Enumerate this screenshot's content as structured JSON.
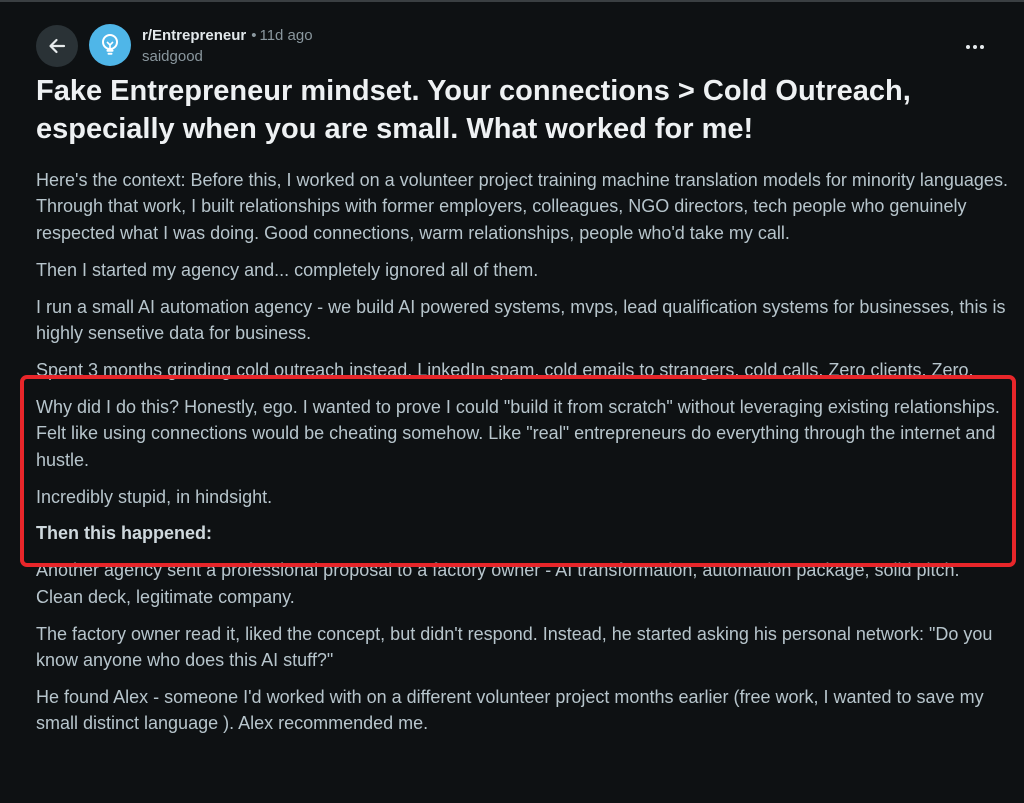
{
  "header": {
    "subreddit": "r/Entrepreneur",
    "separator": "•",
    "time_ago": "11d ago",
    "author": "saidgood",
    "back_icon": "arrow-left-icon",
    "avatar_icon": "lightbulb-icon",
    "more_icon": "more-horizontal-icon"
  },
  "post": {
    "title": "Fake Entrepreneur mindset. Your connections > Cold Outreach, especially when you are small. What worked for me!",
    "paragraphs": [
      "Here's the context: Before this, I worked on a volunteer project training machine translation models for minority languages. Through that work, I built relationships with former employers, colleagues, NGO directors, tech people who genuinely respected what I was doing. Good connections, warm relationships, people who'd take my call.",
      "Then I started my agency and... completely ignored all of them.",
      "I run a small AI automation agency - we build AI powered systems, mvps, lead qualification systems for businesses, this is highly sensetive data for business.",
      "Spent 3 months grinding cold outreach instead. LinkedIn spam, cold emails to strangers, cold calls. Zero clients. Zero.",
      "Why did I do this? Honestly, ego. I wanted to prove I could \"build it from scratch\" without leveraging existing relationships. Felt like using connections would be cheating somehow. Like \"real\" entrepreneurs do everything through the internet and hustle.",
      "Incredibly stupid, in hindsight.",
      "Then this happened:",
      "Another agency sent a professional proposal to a factory owner - AI transformation, automation package, solid pitch. Clean deck, legitimate company.",
      "The factory owner read it, liked the concept, but didn't respond. Instead, he started asking his personal network: \"Do you know anyone who does this AI stuff?\"",
      "He found Alex - someone I'd worked with on a different volunteer project months earlier (free work, I wanted to save my small distinct language ). Alex recommended me."
    ]
  },
  "colors": {
    "background": "#0e1113",
    "highlight_border": "#e8262a",
    "avatar_bg": "#4fb6e8"
  }
}
